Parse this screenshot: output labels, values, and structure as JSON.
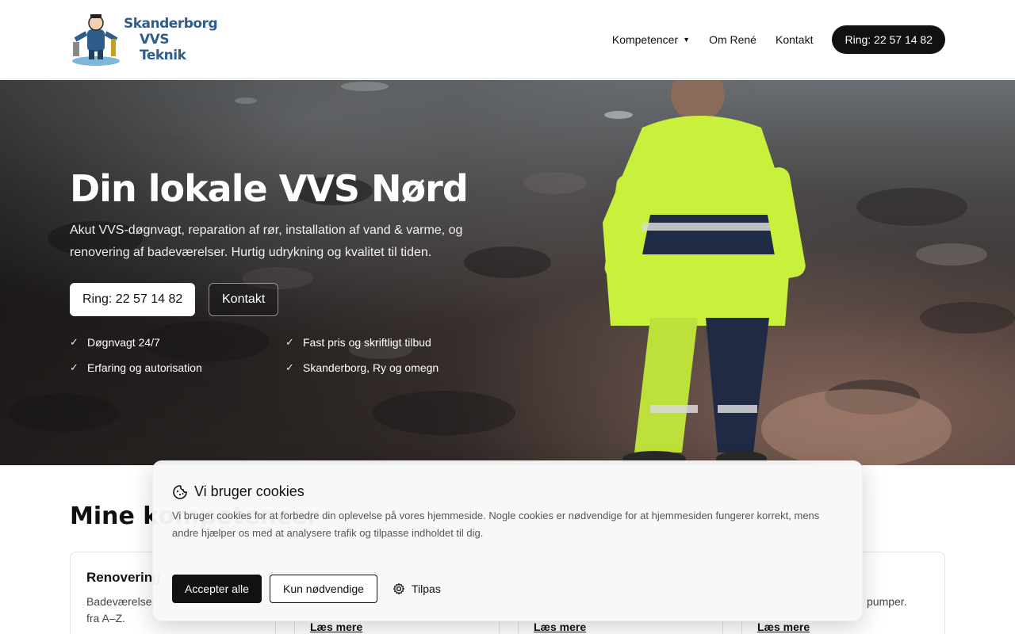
{
  "header": {
    "logo_line1": "Skanderborg",
    "logo_line2": "VVS Teknik",
    "nav": {
      "competences": "Kompetencer",
      "about": "Om René",
      "contact": "Kontakt",
      "call": "Ring: 22 57 14 82"
    }
  },
  "hero": {
    "title": "Din lokale VVS Nørd",
    "subtitle": "Akut VVS-døgnvagt, reparation af rør, installation af vand & varme, og renovering af badeværelser. Hurtig udrykning og kvalitet til tiden.",
    "call_button": "Ring: 22 57 14 82",
    "contact_button": "Kontakt",
    "features": [
      "Døgnvagt 24/7",
      "Fast pris og skriftligt tilbud",
      "Erfaring og autorisation",
      "Skanderborg, Ry og omegn"
    ]
  },
  "competences": {
    "title": "Mine kompetencer",
    "cards": [
      {
        "title": "Renovering",
        "text": "Badeværelser fra A–Z.",
        "link": "Læs mere"
      },
      {
        "title": "",
        "text": "",
        "link": "Læs mere"
      },
      {
        "title": "",
        "text": "",
        "link": "Læs mere"
      },
      {
        "title": "",
        "text": "pumper.",
        "link": "Læs mere"
      }
    ]
  },
  "cookie": {
    "title": "Vi bruger cookies",
    "text": "Vi bruger cookies for at forbedre din oplevelse på vores hjemmeside. Nogle cookies er nødvendige for at hjemmesiden fungerer korrekt, mens andre hjælper os med at analysere trafik og tilpasse indholdet til dig.",
    "accept_all": "Accepter alle",
    "only_necessary": "Kun nødvendige",
    "customize": "Tilpas"
  },
  "icons": {
    "cookie": "cookie-icon",
    "settings": "gear-icon",
    "check": "check-icon",
    "caret": "chevron-down-icon"
  },
  "colors": {
    "brand_blue": "#2f5d8a",
    "dark": "#111111",
    "hi_vis_yellow": "#c9f03a"
  }
}
